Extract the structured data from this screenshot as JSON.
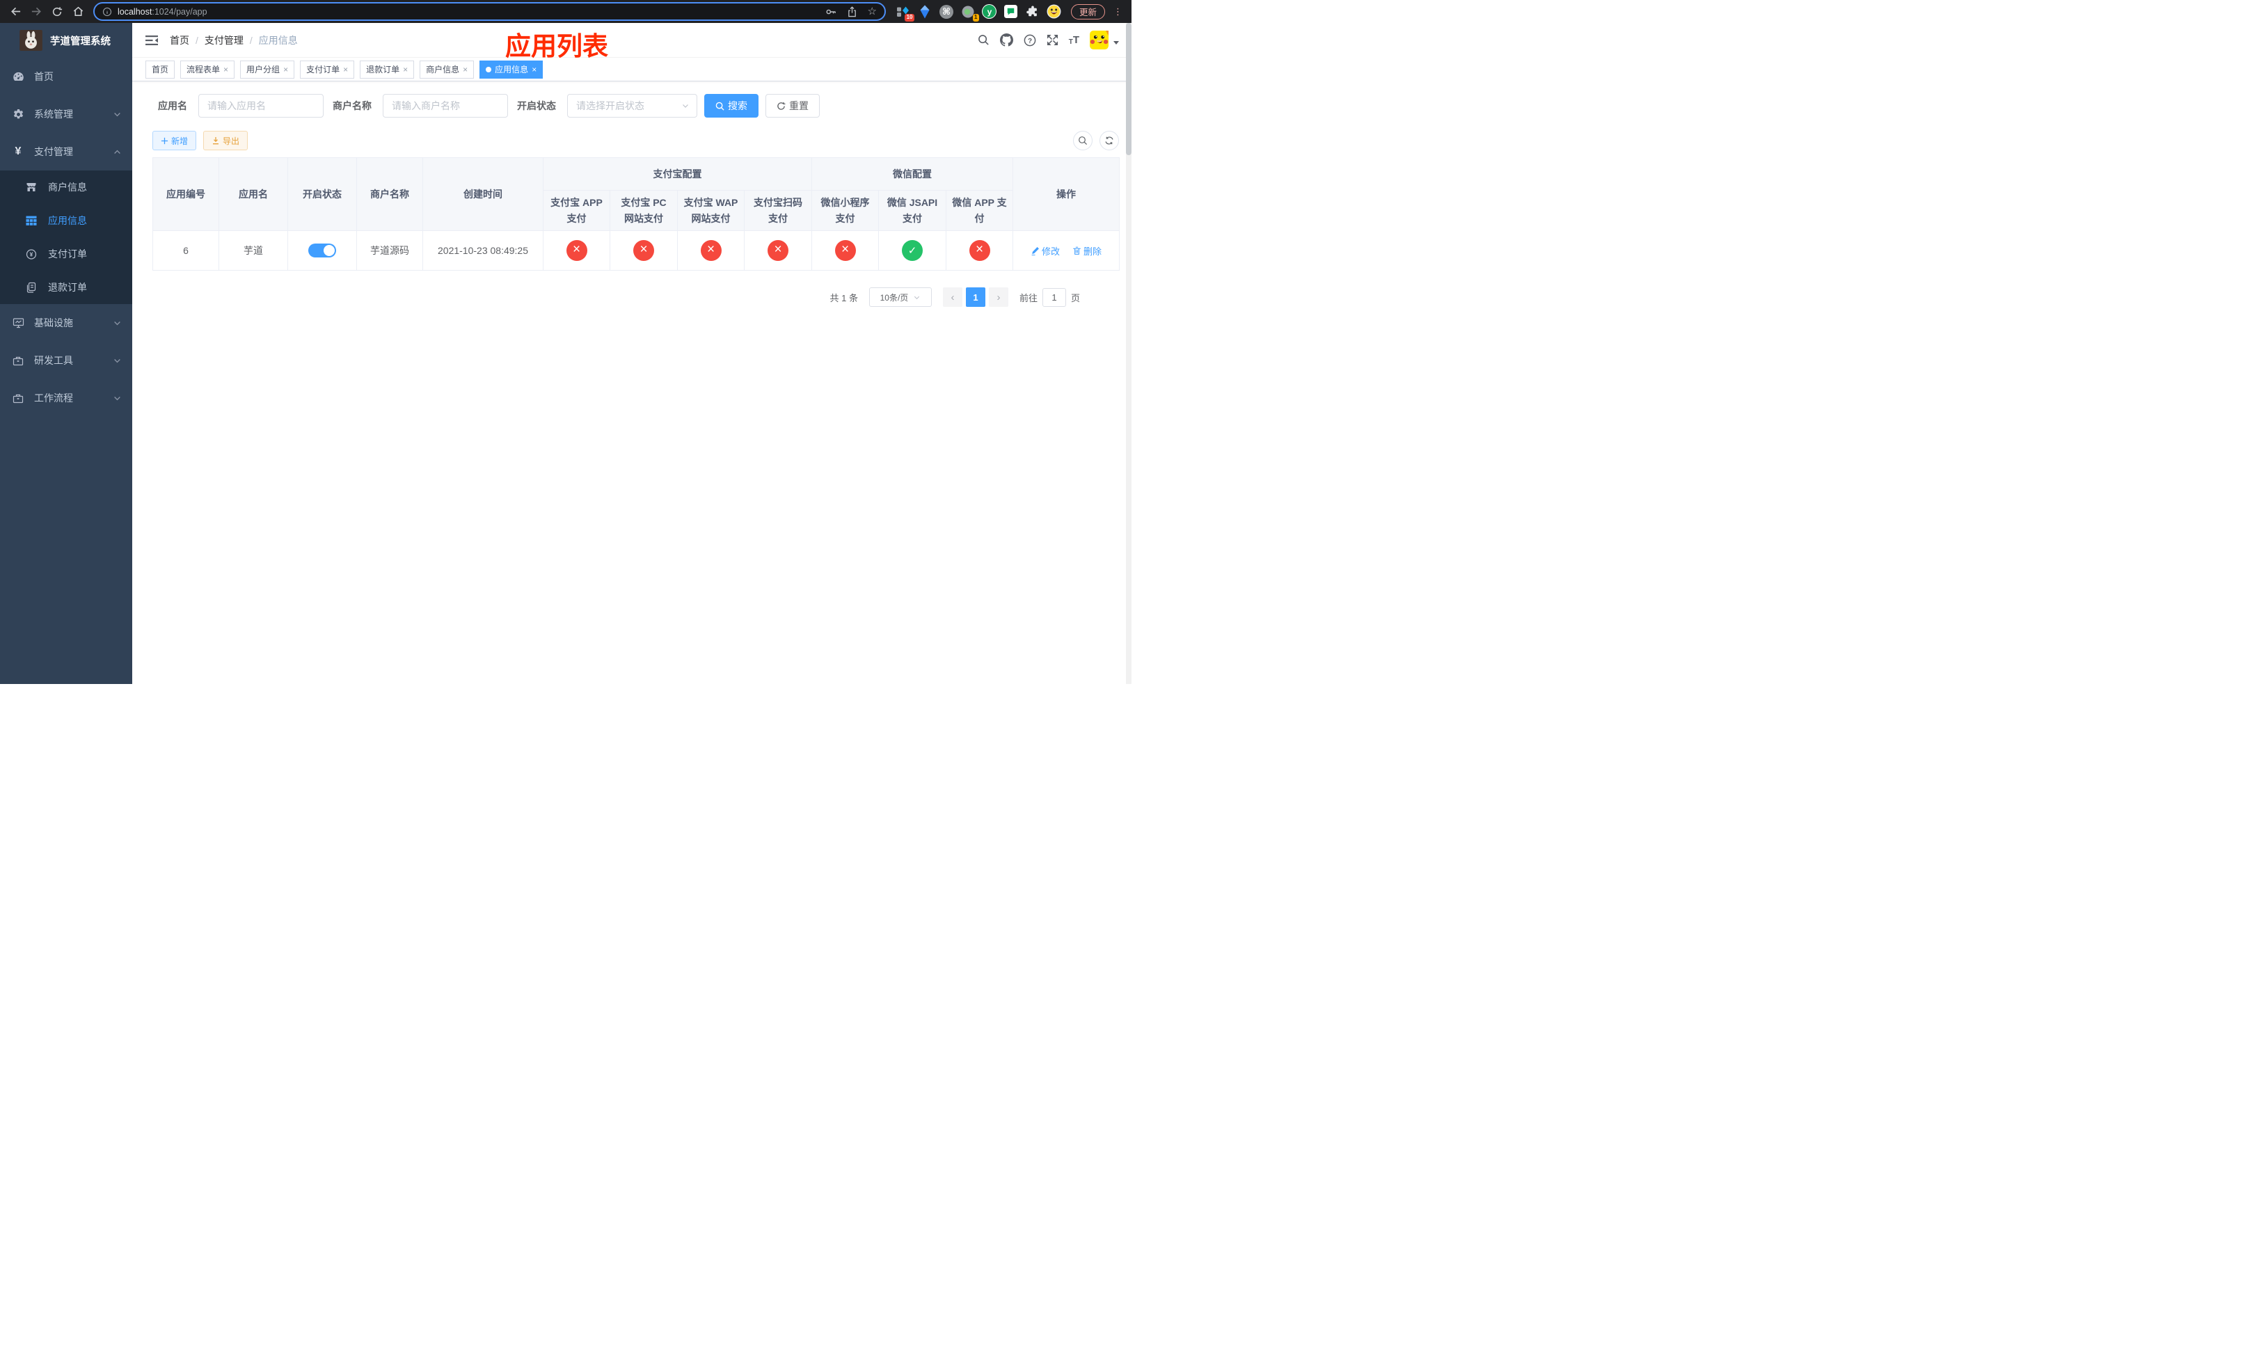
{
  "browser": {
    "url_host": "localhost",
    "url_path": ":1024/pay/app",
    "update_button": "更新",
    "badge_extensions": "10",
    "badge_recorder": "1",
    "cmd_glyph": "⌘",
    "y_glyph": "y"
  },
  "glyphs": {
    "close": "×",
    "star": "☆",
    "dots": "⋮",
    "slash": "/",
    "prev": "‹",
    "next": "›",
    "question": "?",
    "t_small": "T",
    "t_big": "T",
    "yen": "¥",
    "yen_circle": "¥"
  },
  "sidebar": {
    "title": "芋道管理系统",
    "items": [
      {
        "label": "首页"
      },
      {
        "label": "系统管理"
      },
      {
        "label": "支付管理"
      },
      {
        "label": "商户信息"
      },
      {
        "label": "应用信息"
      },
      {
        "label": "支付订单"
      },
      {
        "label": "退款订单"
      },
      {
        "label": "基础设施"
      },
      {
        "label": "研发工具"
      },
      {
        "label": "工作流程"
      }
    ]
  },
  "breadcrumb": {
    "home": "首页",
    "section": "支付管理",
    "current": "应用信息"
  },
  "annotation": {
    "text": "应用列表"
  },
  "tags": {
    "items": [
      {
        "label": "首页"
      },
      {
        "label": "流程表单"
      },
      {
        "label": "用户分组"
      },
      {
        "label": "支付订单"
      },
      {
        "label": "退款订单"
      },
      {
        "label": "商户信息"
      },
      {
        "label": "应用信息"
      }
    ]
  },
  "search": {
    "app_name_label": "应用名",
    "app_name_placeholder": "请输入应用名",
    "merchant_label": "商户名称",
    "merchant_placeholder": "请输入商户名称",
    "status_label": "开启状态",
    "status_placeholder": "请选择开启状态",
    "search_button": "搜索",
    "reset_button": "重置"
  },
  "toolbar": {
    "add": "新增",
    "export": "导出"
  },
  "table": {
    "col_id": "应用编号",
    "col_name": "应用名",
    "col_status": "开启状态",
    "col_merchant": "商户名称",
    "col_created": "创建时间",
    "col_actions": "操作",
    "group_alipay": "支付宝配置",
    "group_wechat": "微信配置",
    "pay_cols": [
      "支付宝 APP 支付",
      "支付宝 PC 网站支付",
      "支付宝 WAP 网站支付",
      "支付宝扫码支付",
      "微信小程序支付",
      "微信 JSAPI 支付",
      "微信 APP 支付"
    ],
    "rows": [
      {
        "id": "6",
        "name": "芋道",
        "enabled": true,
        "merchant": "芋道源码",
        "created": "2021-10-23 08:49:25",
        "statuses": [
          false,
          false,
          false,
          false,
          false,
          true,
          false
        ],
        "edit_label": "修改",
        "delete_label": "删除"
      }
    ]
  },
  "pagination": {
    "total": "共 1 条",
    "page_size": "10条/页",
    "page": "1",
    "goto_label": "前往",
    "goto_value": "1",
    "page_unit": "页"
  },
  "colors": {
    "primary": "#409eff",
    "success": "#24c268",
    "danger": "#f5483d",
    "warning": "#e6a23c",
    "sidebar_bg": "#304156",
    "submenu_bg": "#1f2d3d",
    "annotation": "#ff2b00"
  }
}
